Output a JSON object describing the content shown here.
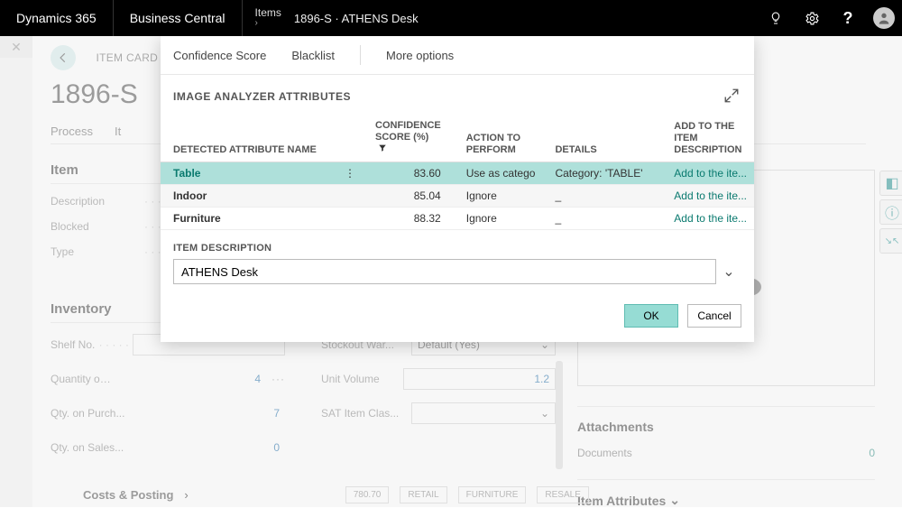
{
  "topbar": {
    "brand1": "Dynamics 365",
    "brand2": "Business Central",
    "crumb_top": "Items",
    "crumb_main": "1896-S · ATHENS Desk"
  },
  "page": {
    "card_label": "ITEM CARD",
    "title_visible": "1896-S",
    "tabs": {
      "process": "Process",
      "item_pfx": "It"
    },
    "sections": {
      "item": "Item",
      "inventory": "Inventory",
      "costs_posting": "Costs & Posting"
    },
    "fields": {
      "description": "Description",
      "blocked": "Blocked",
      "type": "Type",
      "shelf_no": "Shelf No.",
      "qty_on_hand": "Quantity on H...",
      "qty_on_purch": "Qty. on Purch...",
      "qty_on_sales": "Qty. on Sales...",
      "stockout": "Stockout War...",
      "unit_volume": "Unit Volume",
      "sat_item": "SAT Item Clas..."
    },
    "values": {
      "qty_on_hand": "4",
      "qty_on_purch": "7",
      "qty_on_sales": "0",
      "stockout": "Default (Yes)",
      "unit_volume": "1.2"
    },
    "costs_tags": [
      "780.70",
      "RETAIL",
      "FURNITURE",
      "RESALE"
    ]
  },
  "rightcol": {
    "attachments": "Attachments",
    "documents": "Documents",
    "documents_count": "0",
    "item_attributes": "Item Attributes"
  },
  "modal": {
    "tabs": {
      "confidence": "Confidence Score",
      "blacklist": "Blacklist",
      "more": "More options"
    },
    "title": "IMAGE ANALYZER ATTRIBUTES",
    "columns": {
      "name": "DETECTED ATTRIBUTE NAME",
      "conf_l1": "CONFIDENCE",
      "conf_l2": "SCORE (%)",
      "act_l1": "ACTION TO",
      "act_l2": "PERFORM",
      "details": "DETAILS",
      "add_l1": "ADD TO THE",
      "add_l2": "ITEM",
      "add_l3": "DESCRIPTION"
    },
    "rows": [
      {
        "name": "Table",
        "conf": "83.60",
        "action": "Use as catego",
        "details": "Category: 'TABLE'",
        "add": "Add to the ite..."
      },
      {
        "name": "Indoor",
        "conf": "85.04",
        "action": "Ignore",
        "details": "_",
        "add": "Add to the ite..."
      },
      {
        "name": "Furniture",
        "conf": "88.32",
        "action": "Ignore",
        "details": "_",
        "add": "Add to the ite..."
      }
    ],
    "desc_label": "ITEM DESCRIPTION",
    "desc_value": "ATHENS Desk",
    "ok": "OK",
    "cancel": "Cancel"
  }
}
